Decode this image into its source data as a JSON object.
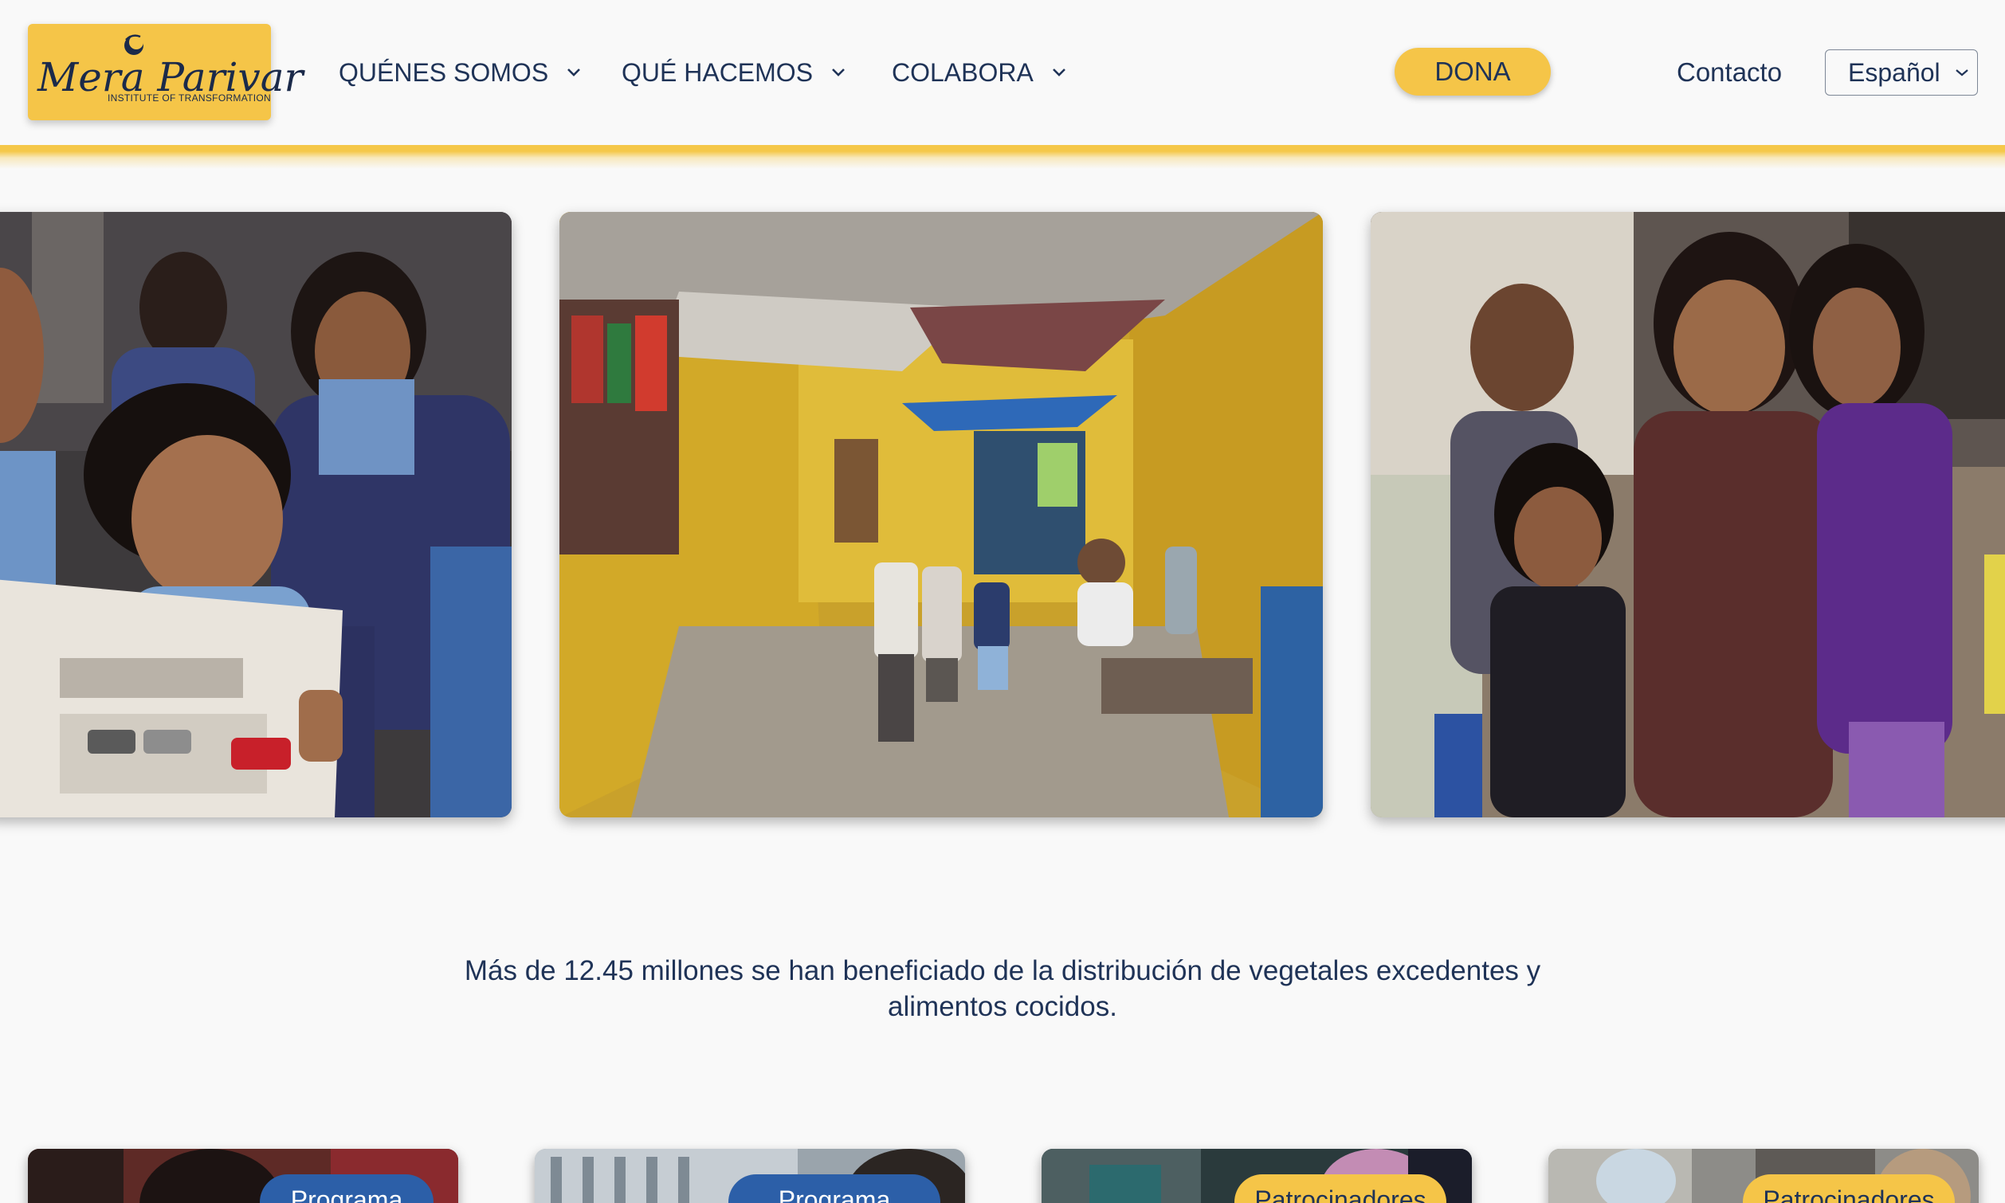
{
  "brand": {
    "name": "Mera Parivar",
    "tagline": "INSTITUTE OF TRANSFORMATION",
    "yellow": "#f5c548",
    "navy": "#1f3357",
    "blue": "#2c5fa8"
  },
  "nav": {
    "items": [
      {
        "label": "QUÉNES SOMOS",
        "icon": "chevron-down-icon"
      },
      {
        "label": "QUÉ HACEMOS",
        "icon": "chevron-down-icon"
      },
      {
        "label": "COLABORA",
        "icon": "chevron-down-icon"
      }
    ],
    "donate_label": "DONA",
    "contact_label": "Contacto",
    "language": "Español"
  },
  "carousel": {
    "slides": [
      {
        "subject": "schoolgirls-reading-newspaper"
      },
      {
        "subject": "children-walking-in-alley"
      },
      {
        "subject": "smiling-children-group"
      }
    ]
  },
  "stat": {
    "text": "Más de 12.45 millones se han beneficiado de la distribución de vegetales excedentes y alimentos cocidos."
  },
  "cards": [
    {
      "tag": "Programa",
      "tag_style": "blue"
    },
    {
      "tag": "Programa",
      "tag_style": "blue"
    },
    {
      "tag": "Patrocinadores",
      "tag_style": "yellow"
    },
    {
      "tag": "Patrocinadores",
      "tag_style": "yellow"
    }
  ]
}
